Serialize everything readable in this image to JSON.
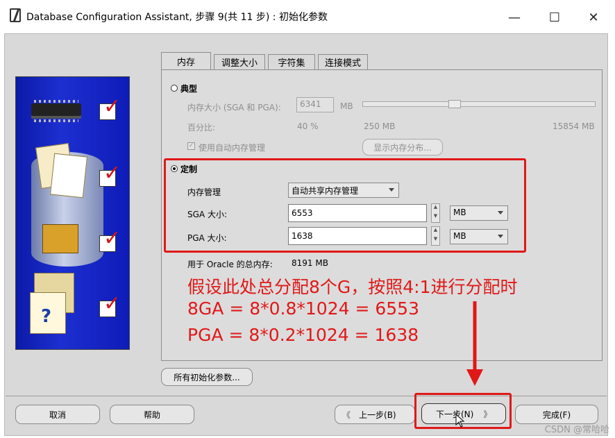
{
  "window": {
    "title": "Database Configuration Assistant, 步骤 9(共 11 步) : 初始化参数",
    "minimize_glyph": "—",
    "maximize_glyph": "☐",
    "close_glyph": "✕"
  },
  "tabs": [
    {
      "label": "内存",
      "active": true
    },
    {
      "label": "调整大小",
      "active": false
    },
    {
      "label": "字符集",
      "active": false
    },
    {
      "label": "连接模式",
      "active": false
    }
  ],
  "typical": {
    "radio_label": "典型",
    "memory_size_label": "内存大小 (SGA 和 PGA):",
    "memory_size_value": "6341",
    "memory_unit": "MB",
    "percent_label": "百分比:",
    "percent_value": "40 %",
    "slider_min": "250 MB",
    "slider_max": "15854 MB",
    "slider_fraction": 0.39,
    "auto_memory_label": "使用自动内存管理",
    "show_distribution_button": "显示内存分布..."
  },
  "custom": {
    "radio_label": "定制",
    "memory_mgmt_label": "内存管理",
    "memory_mgmt_value": "自动共享内存管理",
    "sga_label": "SGA 大小:",
    "sga_value": "6553",
    "sga_unit": "MB",
    "pga_label": "PGA 大小:",
    "pga_value": "1638",
    "pga_unit": "MB",
    "total_label": "用于 Oracle 的总内存:",
    "total_value": "8191 MB"
  },
  "annotation": {
    "line1": "假设此处总分配8个G，按照4:1进行分配时",
    "line2": "8GA = 8*0.8*1024 = 6553",
    "line3": "PGA = 8*0.2*1024 = 1638",
    "color": "#e01818"
  },
  "all_params_button": "所有初始化参数...",
  "footer": {
    "cancel": "取消",
    "help": "帮助",
    "back": "上一步(B)",
    "next": "下一步(N)",
    "finish": "完成(F)"
  },
  "watermark": "CSDN @常哈哈"
}
